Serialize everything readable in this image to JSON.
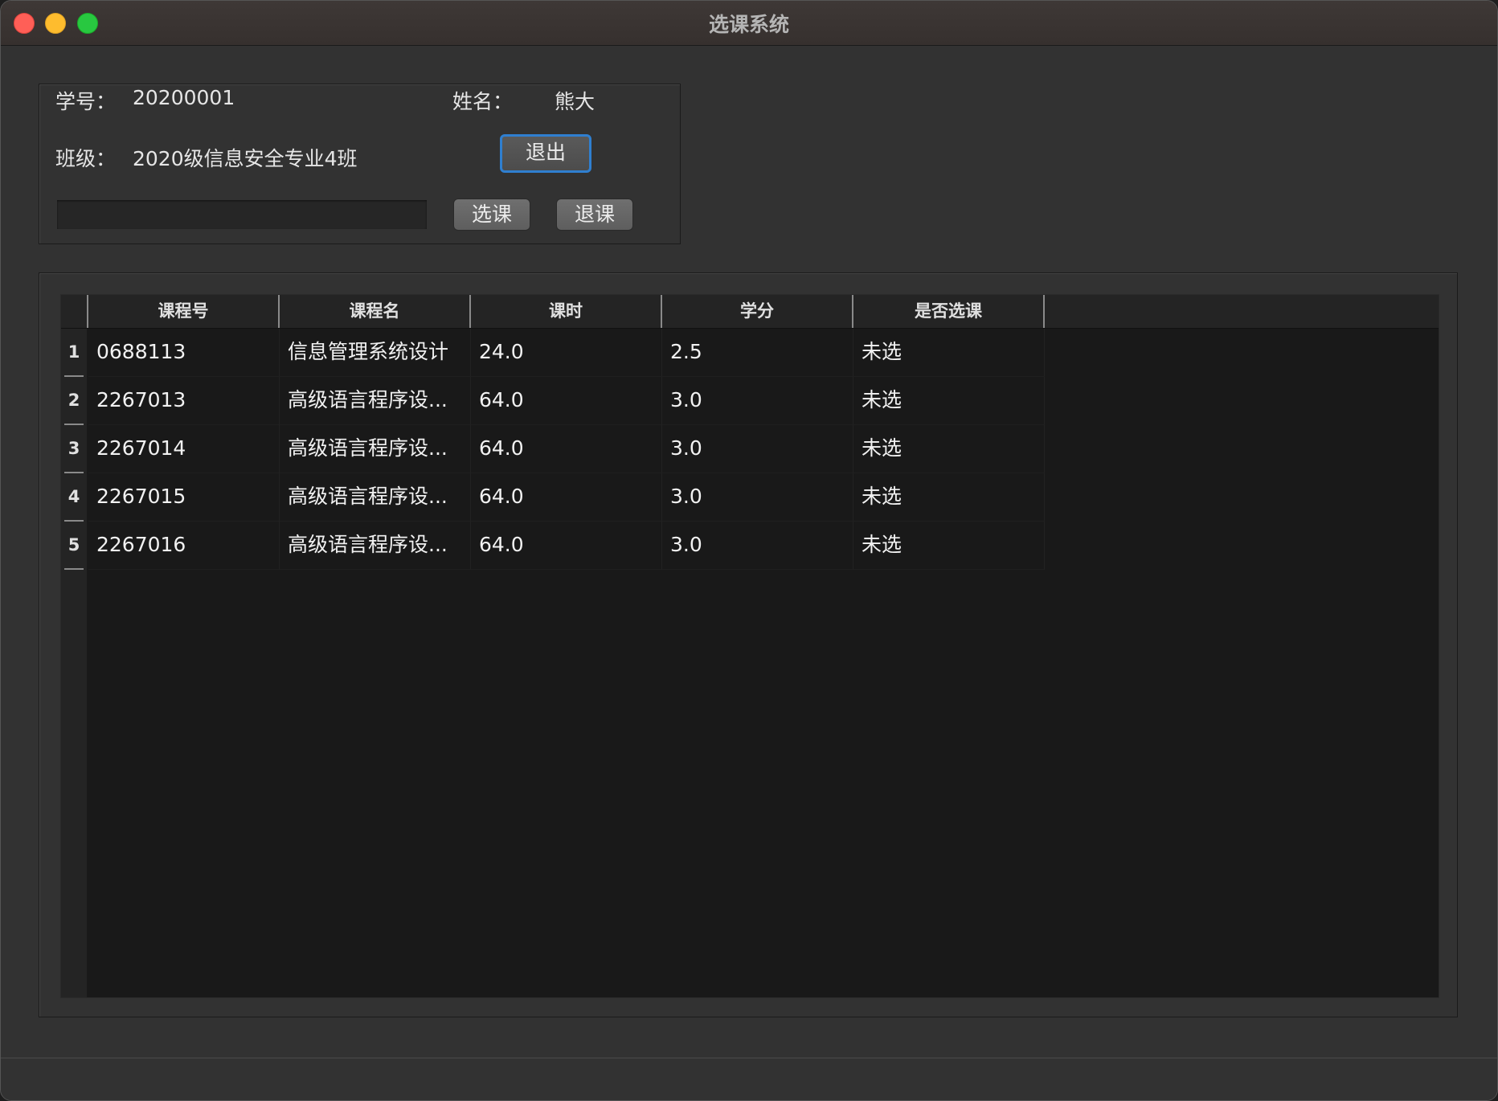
{
  "window": {
    "title": "选课系统"
  },
  "student": {
    "id_label": "学号：",
    "id_value": "20200001",
    "name_label": "姓名：",
    "name_value": "熊大",
    "class_label": "班级：",
    "class_value": "2020级信息安全专业4班"
  },
  "buttons": {
    "exit": "退出",
    "select": "选课",
    "drop": "退课"
  },
  "course_input": {
    "value": "",
    "placeholder": ""
  },
  "table": {
    "headers": [
      "课程号",
      "课程名",
      "课时",
      "学分",
      "是否选课"
    ],
    "rows": [
      {
        "num": "1",
        "id": "0688113",
        "name": "信息管理系统设计",
        "hours": "24.0",
        "credits": "2.5",
        "status": "未选"
      },
      {
        "num": "2",
        "id": "2267013",
        "name": "高级语言程序设...",
        "hours": "64.0",
        "credits": "3.0",
        "status": "未选"
      },
      {
        "num": "3",
        "id": "2267014",
        "name": "高级语言程序设...",
        "hours": "64.0",
        "credits": "3.0",
        "status": "未选"
      },
      {
        "num": "4",
        "id": "2267015",
        "name": "高级语言程序设...",
        "hours": "64.0",
        "credits": "3.0",
        "status": "未选"
      },
      {
        "num": "5",
        "id": "2267016",
        "name": "高级语言程序设...",
        "hours": "64.0",
        "credits": "3.0",
        "status": "未选"
      }
    ]
  }
}
